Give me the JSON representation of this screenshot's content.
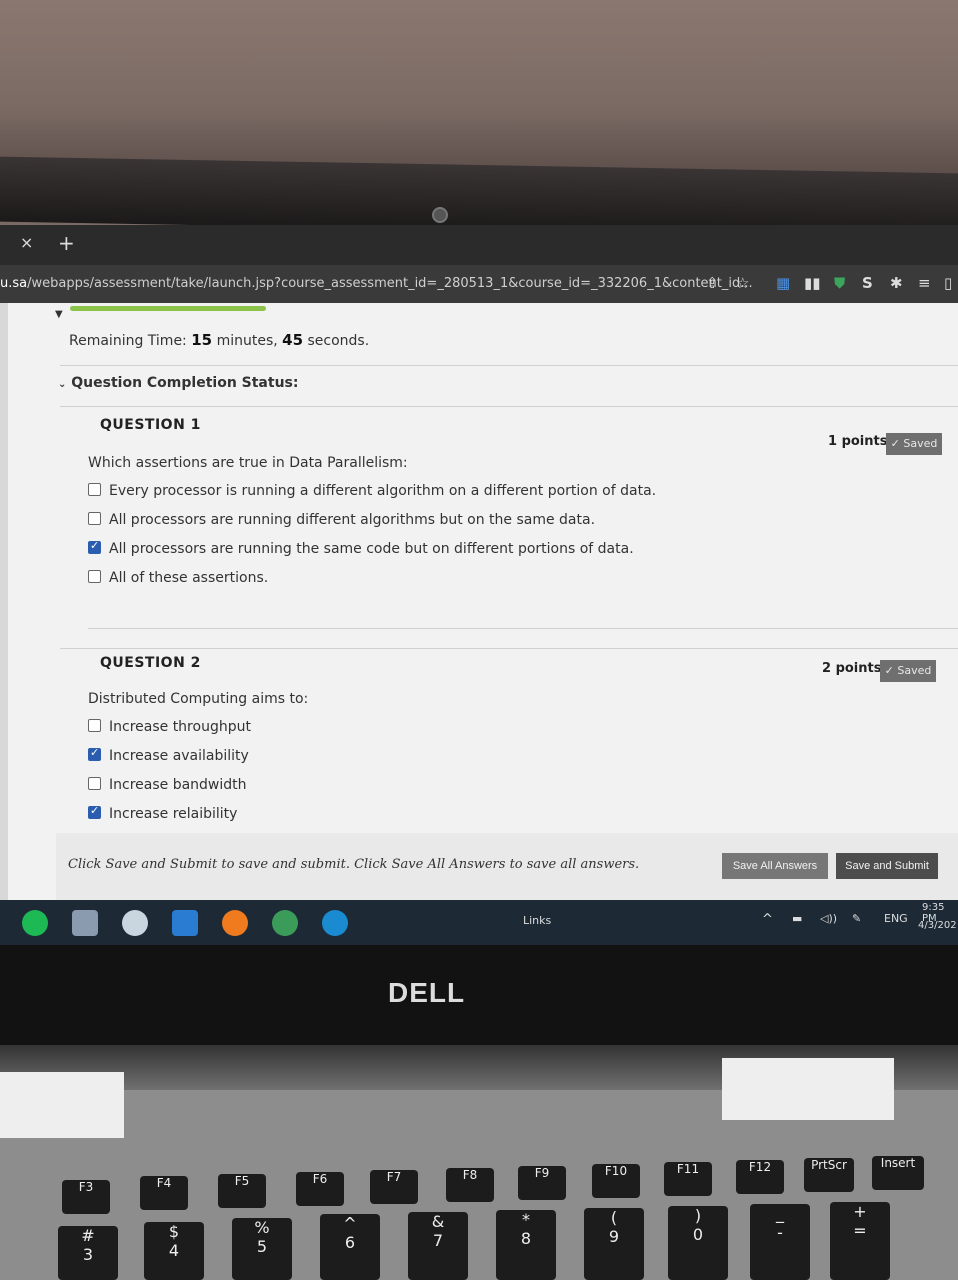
{
  "browser": {
    "tab_close": "×",
    "new_tab": "+",
    "url_domain": "u.sa",
    "url_path": "/webapps/assessment/take/launch.jsp?course_assessment_id=_280513_1&course_id=_332206_1&content_id..."
  },
  "test": {
    "remaining_time_label": "Remaining Time:",
    "remaining_minutes": "15",
    "minutes_word": "minutes,",
    "remaining_seconds": "45",
    "seconds_word": "seconds.",
    "completion_status": "Question Completion Status:"
  },
  "questions": [
    {
      "heading": "QUESTION 1",
      "points": "1 points",
      "saved": "✓ Saved",
      "prompt": "Which assertions are true in Data Parallelism:",
      "options": [
        {
          "label": "Every processor is running a different algorithm on a different portion of data.",
          "checked": false
        },
        {
          "label": "All processors are running different algorithms but on the same data.",
          "checked": false
        },
        {
          "label": "All processors are running the same code but on different portions of data.",
          "checked": true
        },
        {
          "label": "All of these assertions.",
          "checked": false
        }
      ]
    },
    {
      "heading": "QUESTION 2",
      "points": "2 points",
      "saved": "✓ Saved",
      "prompt": "Distributed Computing aims to:",
      "options": [
        {
          "label": "Increase throughput",
          "checked": false
        },
        {
          "label": "Increase availability",
          "checked": true
        },
        {
          "label": "Increase bandwidth",
          "checked": false
        },
        {
          "label": "Increase relaibility",
          "checked": true
        }
      ]
    }
  ],
  "footer": {
    "hint": "Click Save and Submit to save and submit. Click Save All Answers to save all answers.",
    "save_all": "Save All Answers",
    "save_submit": "Save and Submit"
  },
  "taskbar": {
    "links": "Links",
    "lang": "ENG",
    "time": "9:35 PM",
    "date": "4/3/202"
  },
  "laptop": {
    "brand": "DELL",
    "keys_fn": [
      "F3",
      "F4",
      "F5",
      "F6",
      "F7",
      "F8",
      "F9",
      "F10",
      "F11",
      "F12",
      "PrtScr",
      "Insert"
    ],
    "keys_num": [
      "#\n3",
      "$\n4",
      "%\n5",
      "^\n6",
      "&\n7",
      "*\n8",
      "(\n9",
      ")\n0",
      "_\n-",
      "+\n="
    ]
  },
  "colors": {
    "checkbox_checked": "#2a5db0",
    "progress": "#8bc34a",
    "saved_badge": "#6f6f6f",
    "taskbar": "#1d2a36"
  }
}
